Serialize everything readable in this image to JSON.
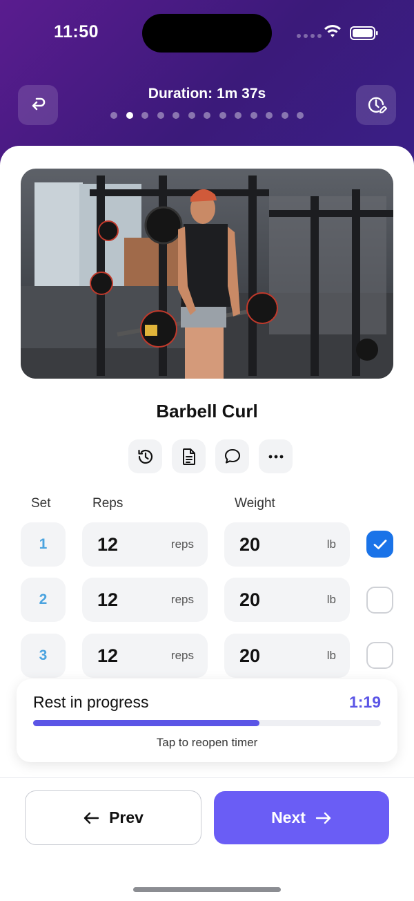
{
  "status_bar": {
    "time": "11:50"
  },
  "header": {
    "duration": "Duration: 1m 37s",
    "page_dots_total": 13,
    "page_dots_active_index": 1,
    "back_icon": "return-arrow-icon",
    "timer_icon": "clock-edit-icon"
  },
  "exercise": {
    "name": "Barbell Curl",
    "actions": [
      {
        "icon": "history-icon"
      },
      {
        "icon": "notes-icon"
      },
      {
        "icon": "comment-icon"
      },
      {
        "icon": "more-icon"
      }
    ]
  },
  "sets_table": {
    "headers": {
      "set": "Set",
      "reps": "Reps",
      "weight": "Weight"
    },
    "rows": [
      {
        "set": "1",
        "reps": "12",
        "reps_unit": "reps",
        "weight": "20",
        "weight_unit": "lb",
        "completed": true
      },
      {
        "set": "2",
        "reps": "12",
        "reps_unit": "reps",
        "weight": "20",
        "weight_unit": "lb",
        "completed": false
      },
      {
        "set": "3",
        "reps": "12",
        "reps_unit": "reps",
        "weight": "20",
        "weight_unit": "lb",
        "completed": false
      }
    ]
  },
  "rest_timer": {
    "title": "Rest in progress",
    "time": "1:19",
    "progress_fraction": 0.65,
    "hint": "Tap to reopen timer"
  },
  "navigation": {
    "prev_label": "Prev",
    "next_label": "Next"
  },
  "colors": {
    "accent": "#6a5df5",
    "check_blue": "#1a73e8",
    "set_number": "#4aa3df",
    "header_gradient_start": "#5a1c8f",
    "header_gradient_end": "#3a1f86"
  }
}
